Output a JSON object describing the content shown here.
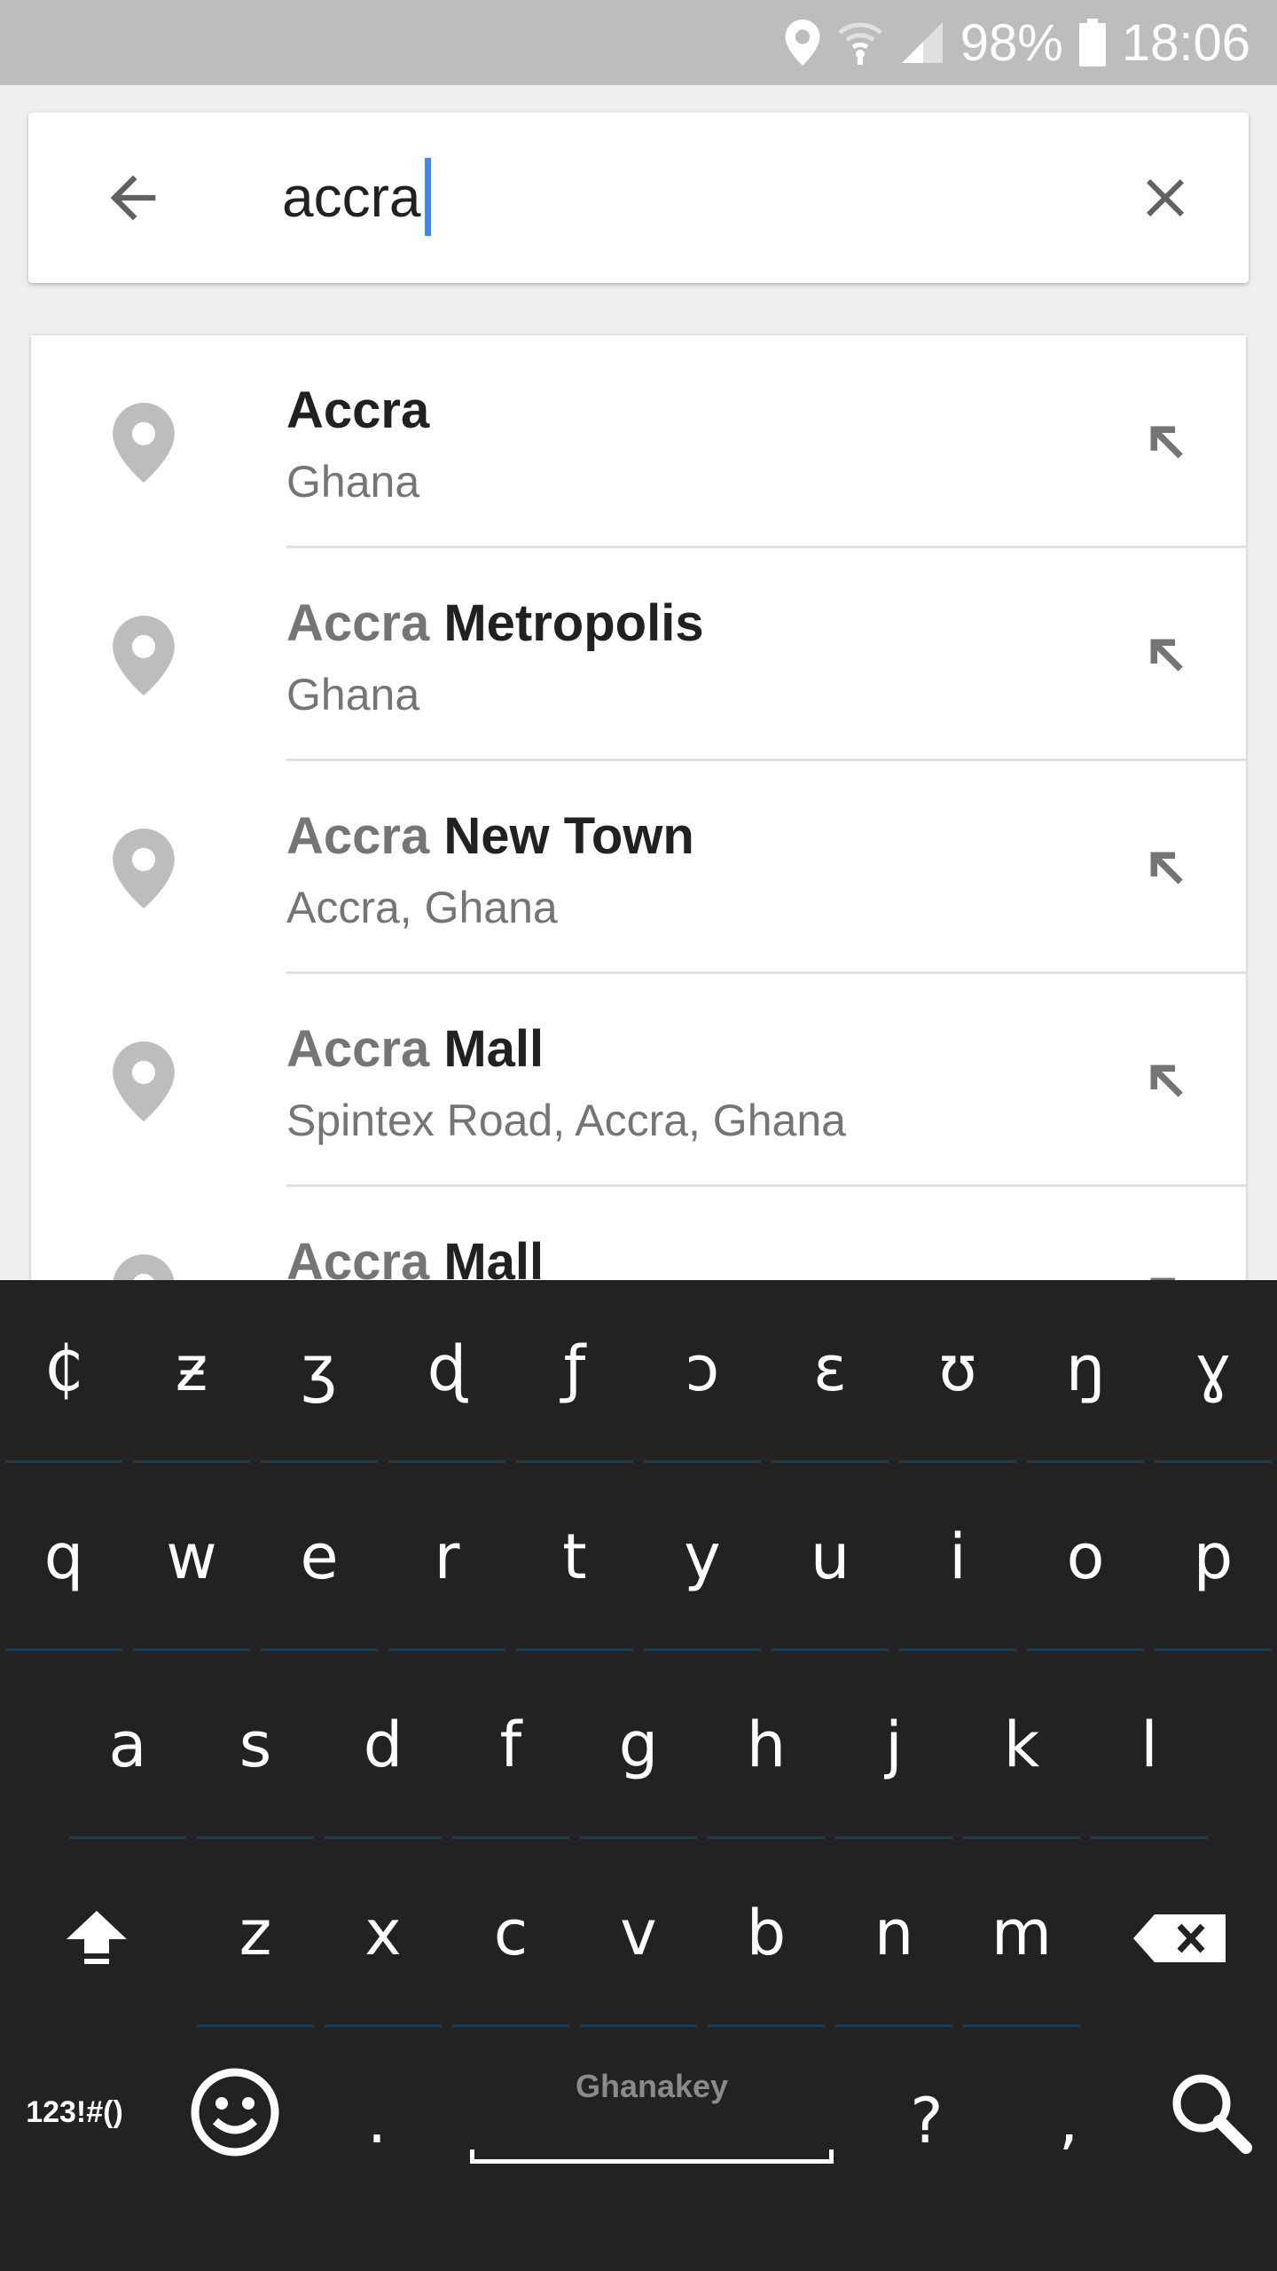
{
  "status_bar": {
    "battery": "98%",
    "time": "18:06",
    "icons": [
      "location-icon",
      "wifi-icon",
      "signal-icon",
      "battery-icon"
    ]
  },
  "search": {
    "query": "accra",
    "back_icon": "arrow-back-icon",
    "clear_icon": "close-icon"
  },
  "results": [
    {
      "highlight": "Accra",
      "rest": "",
      "subtitle": "Ghana"
    },
    {
      "highlight": "Accra",
      "rest": " Metropolis",
      "subtitle": "Ghana"
    },
    {
      "highlight": "Accra",
      "rest": " New Town",
      "subtitle": "Accra, Ghana"
    },
    {
      "highlight": "Accra",
      "rest": " Mall",
      "subtitle": "Spintex Road, Accra, Ghana"
    },
    {
      "highlight": "Accra",
      "rest": " Mall",
      "subtitle": ""
    }
  ],
  "keyboard": {
    "special_row": [
      "₵",
      "ƶ",
      "ʒ",
      "ɖ",
      "ƒ",
      "ɔ",
      "ɛ",
      "ʊ",
      "ŋ",
      "ɣ"
    ],
    "row1": [
      "q",
      "w",
      "e",
      "r",
      "t",
      "y",
      "u",
      "i",
      "o",
      "p"
    ],
    "row2": [
      "a",
      "s",
      "d",
      "f",
      "g",
      "h",
      "j",
      "k",
      "l"
    ],
    "row3": [
      "z",
      "x",
      "c",
      "v",
      "b",
      "n",
      "m"
    ],
    "symbols_label": "123!#()",
    "space_label": "Ghanakey",
    "period": ".",
    "question": "?",
    "comma": ",",
    "shift_icon": "shift-icon",
    "backspace_icon": "backspace-icon",
    "emoji_icon": "emoji-icon",
    "search_icon": "search-icon"
  }
}
